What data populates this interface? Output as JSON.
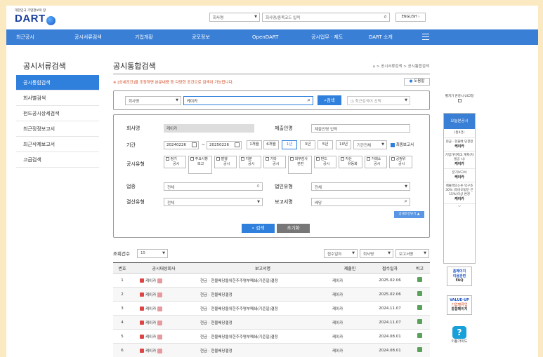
{
  "header": {
    "logo_sub": "대한민국 기업정보의 창",
    "logo_main": "DART",
    "search_type": "회사명",
    "search_placeholder": "회사명/종목코드 입력",
    "english_label": "ENGLISH"
  },
  "nav": [
    "최근공시",
    "공시서류검색",
    "기업개황",
    "공모정보",
    "OpenDART",
    "공시업무 · 제도",
    "DART 소개"
  ],
  "sidebar": {
    "title": "공시서류검색",
    "items": [
      {
        "label": "공시통합검색"
      },
      {
        "label": "회사별검색"
      },
      {
        "label": "펀드공시상세검색"
      },
      {
        "label": "최근정정보고서"
      },
      {
        "label": "최근삭제보고서"
      },
      {
        "label": "고급검색"
      }
    ]
  },
  "main": {
    "title": "공시통합검색",
    "breadcrumb": "> 공시서류검색 > 공시통합검색",
    "notice": "※ [상세조건]을 조정하면 본문내용 등 다양한 조건으로 검색이 가능합니다.",
    "help_label": "도움말"
  },
  "search": {
    "type": "회사명",
    "query": "케이카",
    "button": "검색",
    "recent": "최근검색어 선택"
  },
  "detail": {
    "company_label": "회사명",
    "company_value": "케이카",
    "submitter_label": "제출인명",
    "submitter_placeholder": "제출인명 입력",
    "period_label": "기간",
    "date_from": "20240226",
    "date_to": "20250226",
    "tilde": "~",
    "periods": [
      "1개월",
      "6개월",
      "1년",
      "3년",
      "5년",
      "10년"
    ],
    "period_all": "기간전체",
    "final_report": "최종보고서",
    "types_label": "공시유형",
    "types": [
      {
        "l1": "정기",
        "l2": "공시"
      },
      {
        "l1": "주요사항",
        "l2": "보고"
      },
      {
        "l1": "발행",
        "l2": "공시"
      },
      {
        "l1": "지분",
        "l2": "공시"
      },
      {
        "l1": "기타",
        "l2": "공시"
      },
      {
        "l1": "외부감사",
        "l2": "관련"
      },
      {
        "l1": "펀드",
        "l2": "공시"
      },
      {
        "l1": "자산",
        "l2": "유동화"
      },
      {
        "l1": "거래소",
        "l2": "공시"
      },
      {
        "l1": "공정위",
        "l2": "공시"
      }
    ],
    "industry_label": "업종",
    "industry_value": "전체",
    "corp_type_label": "법인유형",
    "corp_type_value": "전체",
    "settle_label": "결산유형",
    "settle_value": "전체",
    "report_label": "보고서명",
    "report_value": "배당",
    "advanced_label": "상세조건닫기",
    "search_button": "검색",
    "reset_button": "초기화"
  },
  "results": {
    "count_label": "조회건수",
    "count_value": "15",
    "sort": [
      "접수일자",
      "회사명",
      "보고서명"
    ],
    "columns": [
      "번호",
      "공시대상회사",
      "보고서명",
      "제출인",
      "접수일자",
      "비고"
    ],
    "rows": [
      {
        "no": "1",
        "company": "케이카",
        "report": "현금 · 현물배당을위한주주명부폐쇄(기준일)결정",
        "submitter": "케이카",
        "date": "2025.02.06"
      },
      {
        "no": "2",
        "company": "케이카",
        "report": "현금 · 현물배당결정",
        "submitter": "케이카",
        "date": "2025.02.06"
      },
      {
        "no": "3",
        "company": "케이카",
        "report": "현금 · 현물배당을위한주주명부폐쇄(기준일)결정",
        "submitter": "케이카",
        "date": "2024.11.07"
      },
      {
        "no": "4",
        "company": "케이카",
        "report": "현금 · 현물배당결정",
        "submitter": "케이카",
        "date": "2024.11.07"
      },
      {
        "no": "5",
        "company": "케이카",
        "report": "현금 · 현물배당을위한주주명부폐쇄(기준일)결정",
        "submitter": "케이카",
        "date": "2024.08.01"
      },
      {
        "no": "6",
        "company": "케이카",
        "report": "현금 · 현물배당결정",
        "submitter": "케이카",
        "date": "2024.08.01"
      }
    ]
  },
  "rail": {
    "toggle_label": "펼치기 변경시 UI고정",
    "head": "오늘본공시",
    "count": "(총4건)",
    "items": [
      {
        "desc": "현금 · 현물배 당결정",
        "name": "케이카"
      },
      {
        "desc": "기업가치제고 계획(자율공 시)",
        "name": "케이카"
      },
      {
        "desc": "분기보고서",
        "name": "케이카"
      },
      {
        "desc": "매출액또는손 익구조30% (대규모법인 은15%)이상 변경",
        "name": "케이카"
      }
    ],
    "faq_l1": "홈페이지",
    "faq_l2": "이용관련",
    "faq_l3": "FAQ",
    "value_l1": "VALUE-UP",
    "value_l2": "기업밸류업",
    "value_l3": "통합페이지",
    "guide_label": "이용가이드"
  }
}
